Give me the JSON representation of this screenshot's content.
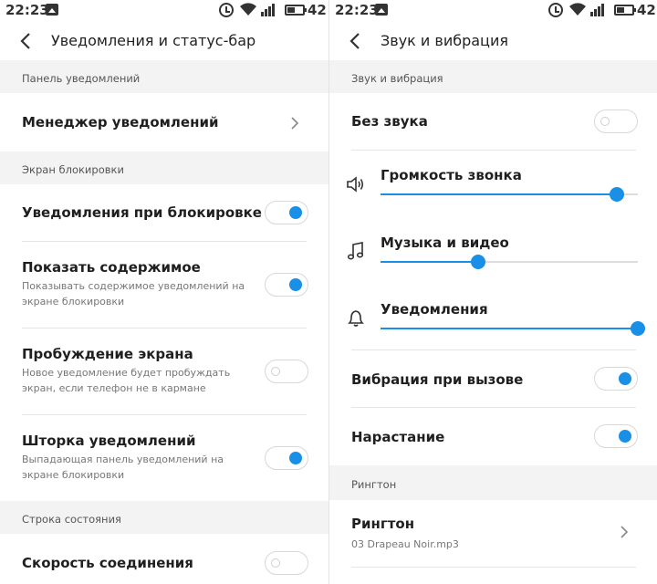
{
  "left": {
    "status": {
      "time": "22:23",
      "battery": "42"
    },
    "header": {
      "title": "Уведомления и статус-бар"
    },
    "sections": {
      "notif_panel": "Панель уведомлений",
      "lock_screen": "Экран блокировки",
      "status_bar": "Строка состояния"
    },
    "items": {
      "manager": "Менеджер уведомлений",
      "lock_notif": {
        "title": "Уведомления при блокировке",
        "on": true
      },
      "show_content": {
        "title": "Показать содержимое",
        "desc": "Показывать содержимое уведомлений на экране блокировки",
        "on": true
      },
      "wake_screen": {
        "title": "Пробуждение экрана",
        "desc": "Новое уведомление будет пробуждать экран, если телефон не в кармане",
        "on": false
      },
      "shade": {
        "title": "Шторка уведомлений",
        "desc": "Выпадающая панель уведомлений на экране блокировки",
        "on": true
      },
      "speed": {
        "title": "Скорость соединения",
        "on": false
      }
    }
  },
  "right": {
    "status": {
      "time": "22:23",
      "battery": "42"
    },
    "header": {
      "title": "Звук и вибрация"
    },
    "sections": {
      "sound_vibration": "Звук и вибрация",
      "ringtone": "Рингтон"
    },
    "items": {
      "silent": {
        "title": "Без звука",
        "on": false
      },
      "ring_volume": {
        "title": "Громкость звонка",
        "level": 0.92
      },
      "media_volume": {
        "title": "Музыка и видео",
        "level": 0.38
      },
      "notif_volume": {
        "title": "Уведомления",
        "level": 1.0
      },
      "vibrate_call": {
        "title": "Вибрация при вызове",
        "on": true
      },
      "ramp": {
        "title": "Нарастание",
        "on": true
      },
      "ringtone": {
        "title": "Рингтон",
        "value": "03 Drapeau Noir.mp3"
      }
    }
  },
  "colors": {
    "accent": "#1a8fe6",
    "section_bg": "#f3f3f3"
  },
  "icons": [
    "back-arrow-icon",
    "chevron-right-icon",
    "speaker-icon",
    "music-note-icon",
    "bell-icon",
    "alarm-icon",
    "wifi-icon",
    "signal-icon",
    "battery-icon",
    "image-notification-icon"
  ]
}
